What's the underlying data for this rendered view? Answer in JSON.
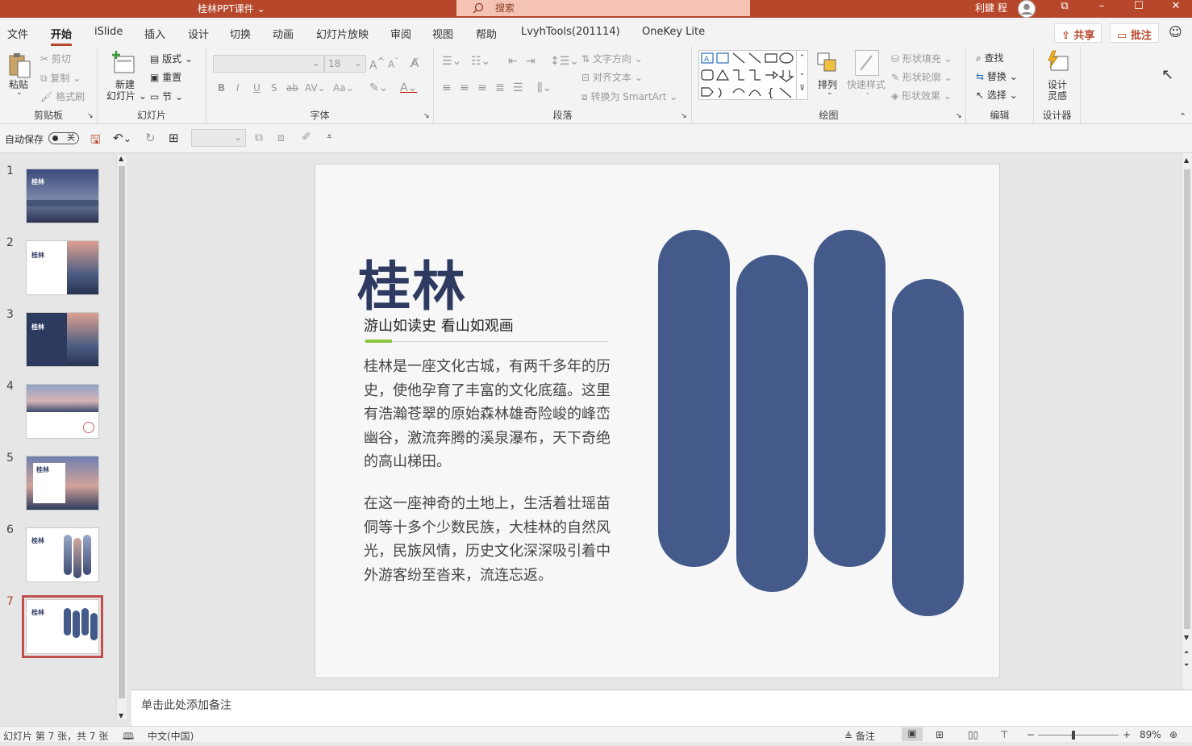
{
  "titlebar": {
    "doc_title": "桂林PPT课件 ⌄",
    "search_placeholder": "搜索",
    "user_name": "利鍵 程",
    "win_restore": "⧉",
    "win_minimize": "–",
    "win_maximize": "☐",
    "win_close": "✕"
  },
  "tabs": [
    {
      "label": "文件"
    },
    {
      "label": "开始"
    },
    {
      "label": "iSlide"
    },
    {
      "label": "插入"
    },
    {
      "label": "设计"
    },
    {
      "label": "切换"
    },
    {
      "label": "动画"
    },
    {
      "label": "幻灯片放映"
    },
    {
      "label": "审阅"
    },
    {
      "label": "视图"
    },
    {
      "label": "帮助"
    },
    {
      "label": "LvyhTools(201114)"
    },
    {
      "label": "OneKey Lite"
    }
  ],
  "share_label": "共享",
  "comment_label": "批注",
  "ribbon": {
    "clipboard": {
      "paste": "粘贴",
      "cut": "剪切",
      "copy": "复制",
      "format_painter": "格式刷",
      "label": "剪贴板"
    },
    "slides": {
      "new_slide_1": "新建",
      "new_slide_2": "幻灯片",
      "layout": "版式",
      "reset": "重置",
      "section": "节",
      "label": "幻灯片"
    },
    "font": {
      "font_size": "18",
      "bold": "B",
      "italic": "I",
      "underline": "U",
      "shadow": "S",
      "strike": "ab",
      "spacing": "AV",
      "case": "Aa",
      "grow": "A",
      "shrink": "A",
      "label": "字体"
    },
    "paragraph": {
      "text_direction": "文字方向",
      "align_text": "对齐文本",
      "smartart": "转换为 SmartArt",
      "label": "段落"
    },
    "drawing": {
      "arrange": "排列",
      "quick_styles": "快速样式",
      "shape_fill": "形状填充",
      "shape_outline": "形状轮廓",
      "shape_effects": "形状效果",
      "label": "绘图"
    },
    "editing": {
      "find": "查找",
      "replace": "替换",
      "select": "选择",
      "label": "编辑"
    },
    "designer": {
      "design_ideas_1": "设计",
      "design_ideas_2": "灵感",
      "label": "设计器"
    }
  },
  "qat": {
    "autosave": "自动保存",
    "toggle": "关"
  },
  "thumbnails": [
    {
      "num": "1",
      "title": "桂林"
    },
    {
      "num": "2",
      "title": "桂林"
    },
    {
      "num": "3",
      "title": "桂林"
    },
    {
      "num": "4",
      "title": ""
    },
    {
      "num": "5",
      "title": "桂林"
    },
    {
      "num": "6",
      "title": "桂林"
    },
    {
      "num": "7",
      "title": "桂林"
    }
  ],
  "slide": {
    "title": "桂林",
    "subtitle": "游山如读史 看山如观画",
    "para1": "桂林是一座文化古城，有两千多年的历史，使他孕育了丰富的文化底蕴。这里有浩瀚苍翠的原始森林雄奇险峻的峰峦幽谷，激流奔腾的溪泉瀑布，天下奇绝的高山梯田。",
    "para2": "在这一座神奇的土地上，生活着壮瑶苗侗等十多个少数民族，大桂林的自然风光，民族风情，历史文化深深吸引着中外游客纷至沓来，流连忘返。",
    "pill_color": "#435a8a"
  },
  "notes_placeholder": "单击此处添加备注",
  "status": {
    "slide_info": "幻灯片 第 7 张，共 7 张",
    "language": "中文(中国)",
    "notes": "备注",
    "zoom": "89%",
    "zoom_minus": "−",
    "zoom_plus": "+"
  },
  "colors": {
    "accent": "#b7472a",
    "slide_title": "#2e3a60",
    "green_accent": "#8dc63f"
  }
}
